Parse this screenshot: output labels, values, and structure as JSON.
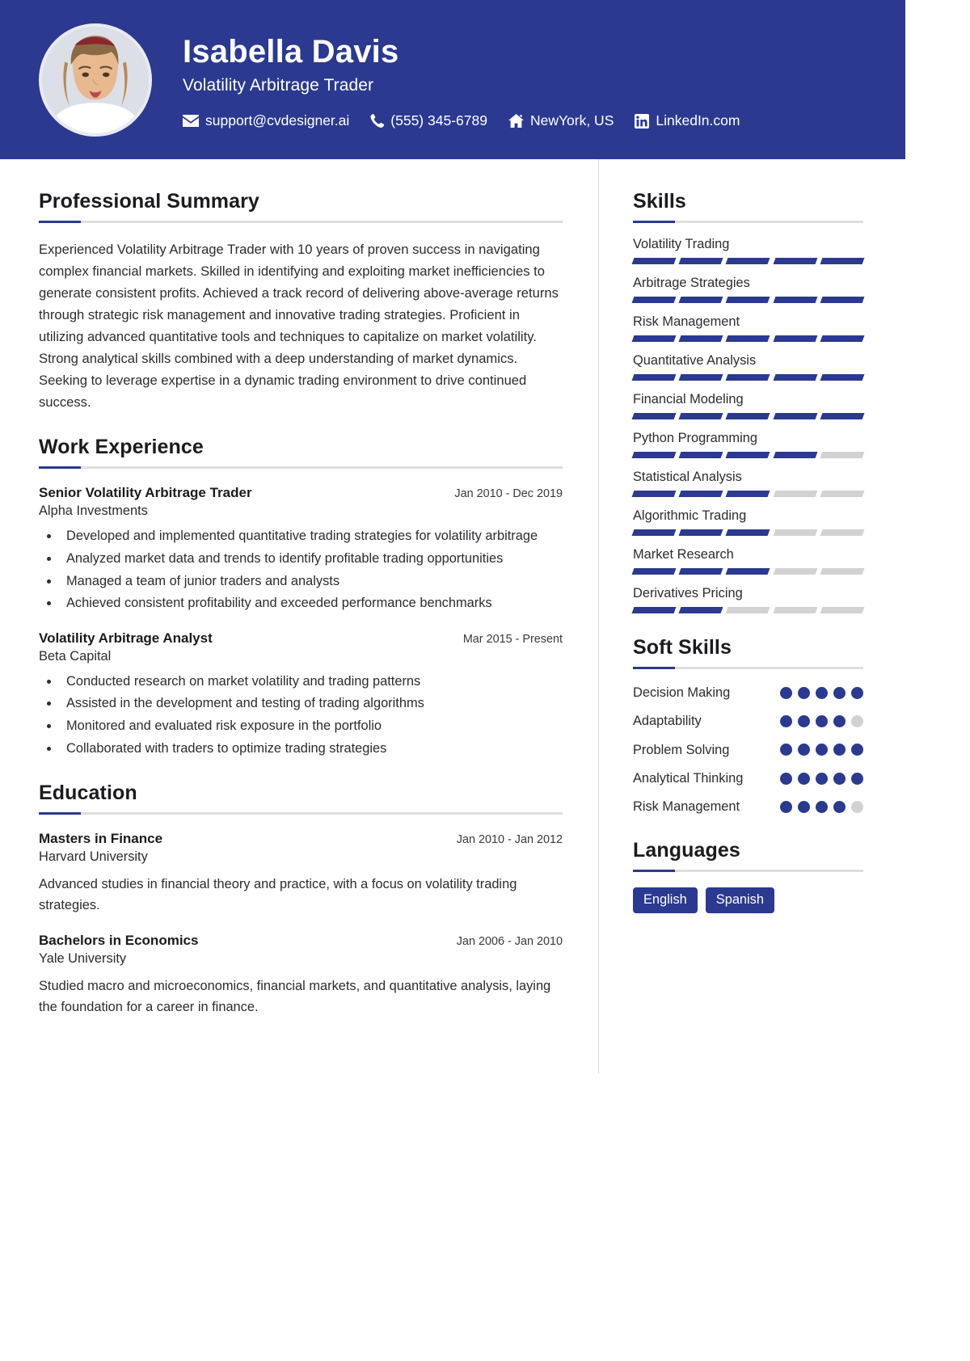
{
  "colors": {
    "brand": "#2b3990",
    "track": "#d2d2d2",
    "rule": "#dedede",
    "text": "#2c2c31"
  },
  "header": {
    "name": "Isabella Davis",
    "job_title": "Volatility Arbitrage Trader",
    "avatar_alt": "profile-photo",
    "contacts": [
      {
        "icon": "envelope-icon",
        "label": "support@cvdesigner.ai"
      },
      {
        "icon": "phone-icon",
        "label": "(555) 345-6789"
      },
      {
        "icon": "home-icon",
        "label": "NewYork, US"
      },
      {
        "icon": "linkedin-icon",
        "label": "LinkedIn.com"
      }
    ]
  },
  "summary": {
    "heading": "Professional Summary",
    "text": "Experienced Volatility Arbitrage Trader with 10 years of proven success in navigating complex financial markets. Skilled in identifying and exploiting market inefficiencies to generate consistent profits. Achieved a track record of delivering above-average returns through strategic risk management and innovative trading strategies. Proficient in utilizing advanced quantitative tools and techniques to capitalize on market volatility. Strong analytical skills combined with a deep understanding of market dynamics. Seeking to leverage expertise in a dynamic trading environment to drive continued success."
  },
  "experience": {
    "heading": "Work Experience",
    "entries": [
      {
        "role": "Senior Volatility Arbitrage Trader",
        "date": "Jan 2010 - Dec 2019",
        "org": "Alpha Investments",
        "bullets": [
          "Developed and implemented quantitative trading strategies for volatility arbitrage",
          "Analyzed market data and trends to identify profitable trading opportunities",
          "Managed a team of junior traders and analysts",
          "Achieved consistent profitability and exceeded performance benchmarks"
        ]
      },
      {
        "role": "Volatility Arbitrage Analyst",
        "date": "Mar 2015 - Present",
        "org": "Beta Capital",
        "bullets": [
          "Conducted research on market volatility and trading patterns",
          "Assisted in the development and testing of trading algorithms",
          "Monitored and evaluated risk exposure in the portfolio",
          "Collaborated with traders to optimize trading strategies"
        ]
      }
    ]
  },
  "education": {
    "heading": "Education",
    "entries": [
      {
        "role": "Masters in Finance",
        "date": "Jan 2010 - Jan 2012",
        "org": "Harvard University",
        "desc": "Advanced studies in financial theory and practice, with a focus on volatility trading strategies."
      },
      {
        "role": "Bachelors in Economics",
        "date": "Jan 2006 - Jan 2010",
        "org": "Yale University",
        "desc": "Studied macro and microeconomics, financial markets, and quantitative analysis, laying the foundation for a career in finance."
      }
    ]
  },
  "skills": {
    "heading": "Skills",
    "max": 5,
    "items": [
      {
        "name": "Volatility Trading",
        "level": 5
      },
      {
        "name": "Arbitrage Strategies",
        "level": 5
      },
      {
        "name": "Risk Management",
        "level": 5
      },
      {
        "name": "Quantitative Analysis",
        "level": 5
      },
      {
        "name": "Financial Modeling",
        "level": 5
      },
      {
        "name": "Python Programming",
        "level": 4
      },
      {
        "name": "Statistical Analysis",
        "level": 3
      },
      {
        "name": "Algorithmic Trading",
        "level": 3
      },
      {
        "name": "Market Research",
        "level": 3
      },
      {
        "name": "Derivatives Pricing",
        "level": 2
      }
    ]
  },
  "soft_skills": {
    "heading": "Soft Skills",
    "max": 5,
    "items": [
      {
        "name": "Decision Making",
        "level": 5
      },
      {
        "name": "Adaptability",
        "level": 4
      },
      {
        "name": "Problem Solving",
        "level": 5
      },
      {
        "name": "Analytical Thinking",
        "level": 5
      },
      {
        "name": "Risk Management",
        "level": 4
      }
    ]
  },
  "languages": {
    "heading": "Languages",
    "items": [
      "English",
      "Spanish"
    ]
  }
}
